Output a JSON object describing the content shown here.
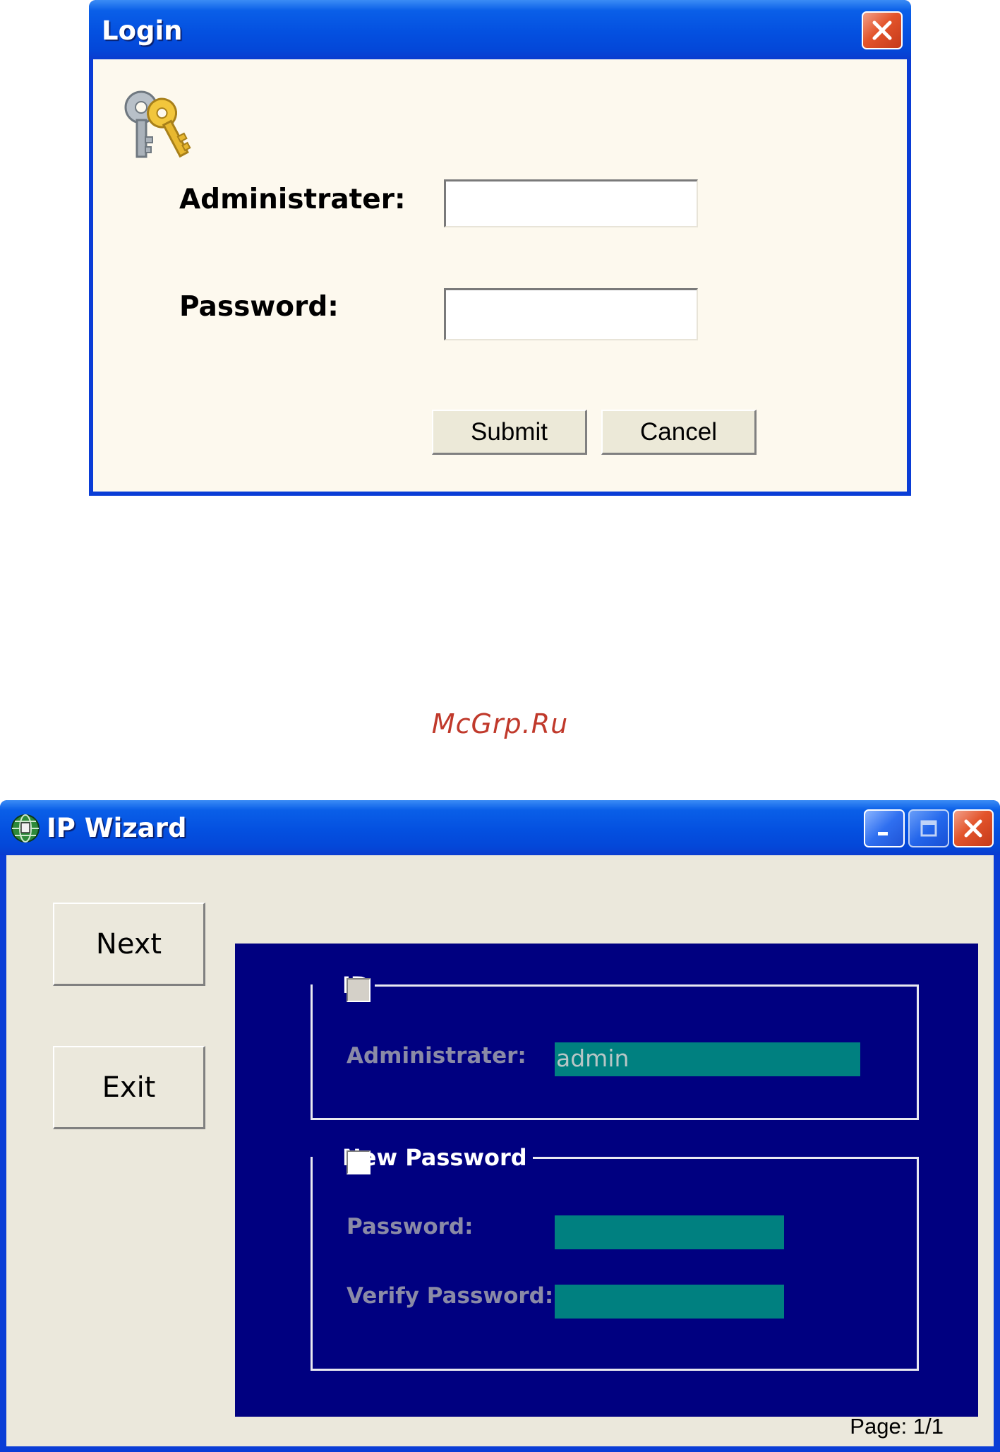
{
  "login_dialog": {
    "title": "Login",
    "administrator_label": "Administrater:",
    "administrator_value": "",
    "password_label": "Password:",
    "password_value": "",
    "submit_label": "Submit",
    "cancel_label": "Cancel",
    "icon": "keys-icon"
  },
  "watermark": "McGrp.Ru",
  "ip_wizard": {
    "title": "IP Wizard",
    "app_icon": "network-globe-icon",
    "next_label": "Next",
    "exit_label": "Exit",
    "id_group": {
      "legend": "ID",
      "checked": false,
      "administrator_label": "Administrater:",
      "administrator_value": "admin"
    },
    "password_group": {
      "legend": "New Password",
      "checked": false,
      "password_label": "Password:",
      "password_value": "",
      "verify_label": "Verify Password:",
      "verify_value": ""
    },
    "page_indicator": "Page: 1/1"
  },
  "colors": {
    "xp_title_blue": "#0450e0",
    "dialog_bg": "#fdf9ee",
    "wizard_panel": "#000080",
    "field_teal": "#008080",
    "close_red": "#e3542b"
  }
}
